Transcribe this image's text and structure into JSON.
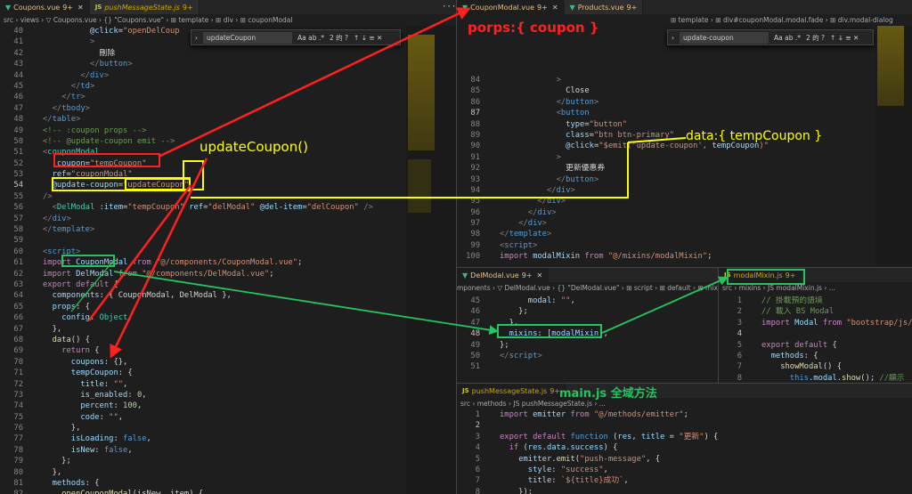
{
  "left": {
    "tabs": [
      {
        "name": "Coupons.vue",
        "badge": "9+",
        "kind": "vue"
      },
      {
        "name": "pushMessageState.js",
        "badge": "9+",
        "kind": "js"
      }
    ],
    "breadcrumb": "src › views › ▽ Coupons.vue › {} \"Coupons.vue\" › ⊞ template › ⊞ div › ⊞ couponModal",
    "find": {
      "value": "updateCoupon",
      "opts": "Aa  ab  .*",
      "count": "2 的 ?",
      "arrows": "↑  ↓  ≡  ✕"
    },
    "lines": [
      {
        "n": "40",
        "html": "<span class='w'>          </span><span class='a'>@click</span><span class='w'>=</span><span class='s'>\"openDelCoup</span>"
      },
      {
        "n": "41",
        "html": "<span class='w'>          </span><span class='p'>&gt;</span>"
      },
      {
        "n": "42",
        "html": "<span class='w'>            刪除</span>"
      },
      {
        "n": "43",
        "html": "<span class='w'>          </span><span class='p'>&lt;/</span><span class='t'>button</span><span class='p'>&gt;</span>"
      },
      {
        "n": "44",
        "html": "<span class='w'>        </span><span class='p'>&lt;/</span><span class='t'>div</span><span class='p'>&gt;</span>"
      },
      {
        "n": "45",
        "html": "<span class='w'>      </span><span class='p'>&lt;/</span><span class='t'>td</span><span class='p'>&gt;</span>"
      },
      {
        "n": "46",
        "html": "<span class='w'>    </span><span class='p'>&lt;/</span><span class='t'>tr</span><span class='p'>&gt;</span>"
      },
      {
        "n": "47",
        "html": "<span class='w'>  </span><span class='p'>&lt;/</span><span class='t'>tbody</span><span class='p'>&gt;</span>"
      },
      {
        "n": "48",
        "html": "<span class='p'>&lt;/</span><span class='t'>table</span><span class='p'>&gt;</span>"
      },
      {
        "n": "49",
        "html": "<span class='c'>&lt;!-- :coupon props --&gt;</span>"
      },
      {
        "n": "50",
        "html": "<span class='c'>&lt;!-- @update-coupon emit --&gt;</span>"
      },
      {
        "n": "51",
        "html": "<span class='p'>&lt;</span><span class='g'>couponModal</span>"
      },
      {
        "n": "52",
        "html": "<span class='w'>  </span><span class='a'>:coupon</span><span class='w'>=</span><span class='s'>\"tempCoupon\"</span>"
      },
      {
        "n": "53",
        "html": "<span class='w'>  </span><span class='a'>ref</span><span class='w'>=</span><span class='s'>\"couponModal\"</span>"
      },
      {
        "n": "54",
        "html": "<span class='w'>  </span><span class='a'>@update-coupon</span><span class='w'>=</span><span class='s'>\"updateCoupon\"</span>"
      },
      {
        "n": "55",
        "html": "<span class='p'>/&gt;</span>"
      },
      {
        "n": "56",
        "html": "<span class='p'>&lt;</span><span class='g'>DelModal</span><span class='w'> </span><span class='a'>:item</span><span class='w'>=</span><span class='s'>\"tempCoupon\"</span><span class='w'> </span><span class='a'>ref</span><span class='w'>=</span><span class='s'>\"delModal\"</span><span class='w'> </span><span class='a'>@del-item</span><span class='w'>=</span><span class='s'>\"delCoupon\"</span><span class='w'> </span><span class='p'>/&gt;</span>",
        "indent": "  "
      },
      {
        "n": "57",
        "html": "<span class='p'>&lt;/</span><span class='t'>div</span><span class='p'>&gt;</span>"
      },
      {
        "n": "58",
        "html": "<span class='p'>&lt;/</span><span class='t'>template</span><span class='p'>&gt;</span>"
      },
      {
        "n": "59",
        "html": ""
      },
      {
        "n": "60",
        "html": "<span class='p'>&lt;</span><span class='t'>script</span><span class='p'>&gt;</span>"
      },
      {
        "n": "61",
        "html": "<span class='kw'>import</span><span class='w'> </span><span class='a'>CouponModal</span><span class='w'> </span><span class='kw'>from</span><span class='w'> </span><span class='s'>\"@/components/CouponModal.vue\"</span><span class='w'>;</span>"
      },
      {
        "n": "62",
        "html": "<span class='kw'>import</span><span class='w'> </span><span class='a'>DelModal</span><span class='w'> </span><span class='kw'>from</span><span class='w'> </span><span class='s'>\"@/components/DelModal.vue\"</span><span class='w'>;</span>"
      },
      {
        "n": "63",
        "html": "<span class='kw'>export</span><span class='w'> </span><span class='kw'>default</span><span class='w'> {</span>"
      },
      {
        "n": "64",
        "html": "<span class='w'>  </span><span class='a'>components</span><span class='w'>: { CouponModal, DelModal },</span>"
      },
      {
        "n": "65",
        "html": "<span class='w'>  </span><span class='a'>props</span><span class='w'>: {</span>"
      },
      {
        "n": "66",
        "html": "<span class='w'>    </span><span class='a'>config</span><span class='w'>: </span><span class='g'>Object</span><span class='w'>,</span>"
      },
      {
        "n": "67",
        "html": "<span class='w'>  },</span>"
      },
      {
        "n": "68",
        "html": "<span class='w'>  </span><span class='f'>data</span><span class='w'>() {</span>"
      },
      {
        "n": "69",
        "html": "<span class='w'>    </span><span class='kw'>return</span><span class='w'> {</span>"
      },
      {
        "n": "70",
        "html": "<span class='w'>      </span><span class='a'>coupons</span><span class='w'>: {},</span>"
      },
      {
        "n": "71",
        "html": "<span class='w'>      </span><span class='a'>tempCoupon</span><span class='w'>: {</span>"
      },
      {
        "n": "72",
        "html": "<span class='w'>        </span><span class='a'>title</span><span class='w'>: </span><span class='s'>\"\"</span><span class='w'>,</span>"
      },
      {
        "n": "73",
        "html": "<span class='w'>        </span><span class='a'>is_enabled</span><span class='w'>: </span><span class='nm'>0</span><span class='w'>,</span>"
      },
      {
        "n": "74",
        "html": "<span class='w'>        </span><span class='a'>percent</span><span class='w'>: </span><span class='nm'>100</span><span class='w'>,</span>"
      },
      {
        "n": "75",
        "html": "<span class='w'>        </span><span class='a'>code</span><span class='w'>: </span><span class='s'>\"\"</span><span class='w'>,</span>"
      },
      {
        "n": "76",
        "html": "<span class='w'>      },</span>"
      },
      {
        "n": "77",
        "html": "<span class='w'>      </span><span class='a'>isLoading</span><span class='w'>: </span><span class='k'>false</span><span class='w'>,</span>"
      },
      {
        "n": "78",
        "html": "<span class='w'>      </span><span class='a'>isNew</span><span class='w'>: </span><span class='k'>false</span><span class='w'>,</span>"
      },
      {
        "n": "79",
        "html": "<span class='w'>    };</span>"
      },
      {
        "n": "80",
        "html": "<span class='w'>  },</span>"
      },
      {
        "n": "81",
        "html": "<span class='w'>  </span><span class='a'>methods</span><span class='w'>: {</span>"
      },
      {
        "n": "82",
        "html": "<span class='w'>    </span><span class='f'>openCouponModal</span><span class='w'>(isNew, item) {</span>"
      }
    ]
  },
  "right_top": {
    "tabs": [
      {
        "name": "CouponModal.vue",
        "badge": "9+",
        "kind": "vue"
      },
      {
        "name": "Products.vue",
        "badge": "9+",
        "kind": "vue"
      }
    ],
    "breadcrumb": "⊞ template › ⊞ div#couponModal.modal.fade › ⊞ div.modal-dialog",
    "find": {
      "value": "update-coupon",
      "opts": "Aa  ab  .*",
      "count": "2 的 ?",
      "arrows": "↑  ↓  ≡  ✕"
    },
    "lines": [
      {
        "n": "84",
        "html": "<span class='w'>            </span><span class='p'>&gt;</span>"
      },
      {
        "n": "85",
        "html": "<span class='w'>              Close</span>"
      },
      {
        "n": "86",
        "html": "<span class='w'>            </span><span class='p'>&lt;/</span><span class='t'>button</span><span class='p'>&gt;</span>"
      },
      {
        "n": "87",
        "html": "<span class='w'>            </span><span class='p'>&lt;</span><span class='t'>button</span>"
      },
      {
        "n": "88",
        "html": "<span class='w'>              </span><span class='a'>type</span><span class='w'>=</span><span class='s'>\"button\"</span>"
      },
      {
        "n": "89",
        "html": "<span class='w'>              </span><span class='a'>class</span><span class='w'>=</span><span class='s'>\"btn btn-primary\"</span>"
      },
      {
        "n": "90",
        "html": "<span class='w'>              </span><span class='a'>@click</span><span class='w'>=</span><span class='s'>\"$emit('update-coupon', </span><span class='a'>tempCoupon</span><span class='s'>)\"</span>"
      },
      {
        "n": "91",
        "html": "<span class='w'>            </span><span class='p'>&gt;</span>"
      },
      {
        "n": "92",
        "html": "<span class='w'>              更新優惠券</span>"
      },
      {
        "n": "93",
        "html": "<span class='w'>            </span><span class='p'>&lt;/</span><span class='t'>button</span><span class='p'>&gt;</span>"
      },
      {
        "n": "94",
        "html": "<span class='w'>          </span><span class='p'>&lt;/</span><span class='t'>div</span><span class='p'>&gt;</span>"
      },
      {
        "n": "95",
        "html": "<span class='w'>        </span><span class='p'>&lt;/</span><span class='t'>div</span><span class='p'>&gt;</span>"
      },
      {
        "n": "96",
        "html": "<span class='w'>      </span><span class='p'>&lt;/</span><span class='t'>div</span><span class='p'>&gt;</span>"
      },
      {
        "n": "97",
        "html": "<span class='w'>    </span><span class='p'>&lt;/</span><span class='t'>div</span><span class='p'>&gt;</span>"
      },
      {
        "n": "98",
        "html": "<span class='p'>&lt;/</span><span class='t'>template</span><span class='p'>&gt;</span>"
      },
      {
        "n": "99",
        "html": "<span class='p'>&lt;</span><span class='t'>script</span><span class='p'>&gt;</span>"
      },
      {
        "n": "100",
        "html": "<span class='kw'>import</span><span class='w'> </span><span class='a'>modalMixin</span><span class='w'> </span><span class='kw'>from</span><span class='w'> </span><span class='s'>\"@/mixins/modalMixin\"</span><span class='w'>;</span>"
      }
    ]
  },
  "del_modal": {
    "tab": {
      "name": "DelModal.vue",
      "badge": "9+"
    },
    "breadcrumb": "mponents › ▽ DelModal.vue › {} \"DelModal.vue\" › ⊞ script › ⊞ default › ⊞ mixins",
    "lines": [
      {
        "n": "45",
        "html": "<span class='w'>      </span><span class='a'>modal</span><span class='w'>: </span><span class='s'>\"\"</span><span class='w'>,</span>"
      },
      {
        "n": "46",
        "html": "<span class='w'>    };</span>"
      },
      {
        "n": "47",
        "html": "<span class='w'>  },</span>"
      },
      {
        "n": "48",
        "html": "<span class='w'>  </span><span class='a'>mixins</span><span class='w'>: [</span><span class='a'>modalMixin</span><span class='w'>],</span>"
      },
      {
        "n": "49",
        "html": "<span class='w'>};</span>"
      },
      {
        "n": "50",
        "html": "<span class='p'>&lt;/</span><span class='t'>script</span><span class='p'>&gt;</span>"
      },
      {
        "n": "51",
        "html": ""
      }
    ]
  },
  "modal_mixin": {
    "tab": {
      "name": "modalMixin.js",
      "badge": "9+"
    },
    "breadcrumb": "src › mixins › JS modalMixin.js › ...",
    "lines": [
      {
        "n": "1",
        "html": "<span class='c'>// 掛載預的語境</span>"
      },
      {
        "n": "2",
        "html": "<span class='c'>// 載入 BS Modal</span>"
      },
      {
        "n": "3",
        "html": "<span class='kw'>import</span><span class='w'> </span><span class='a'>Modal</span><span class='w'> </span><span class='kw'>from</span><span class='w'> </span><span class='s'>\"bootstrap/js/dis</span>"
      },
      {
        "n": "4",
        "html": ""
      },
      {
        "n": "5",
        "html": "<span class='kw'>export</span><span class='w'> </span><span class='kw'>default</span><span class='w'> {</span>"
      },
      {
        "n": "6",
        "html": "<span class='w'>  </span><span class='a'>methods</span><span class='w'>: {</span>"
      },
      {
        "n": "7",
        "html": "<span class='w'>    </span><span class='f'>showModal</span><span class='w'>() {</span>"
      },
      {
        "n": "8",
        "html": "<span class='w'>      </span><span class='k'>this</span><span class='w'>.</span><span class='a'>modal</span><span class='w'>.</span><span class='f'>show</span><span class='w'>(); </span><span class='c'>//顯示</span>"
      }
    ]
  },
  "push_message": {
    "tab": {
      "name": "pushMessageState.js",
      "badge": "9+"
    },
    "breadcrumb": "src › methods › JS pushMessageState.js › ...",
    "lines": [
      {
        "n": "1",
        "html": "<span class='kw'>import</span><span class='w'> </span><span class='a'>emitter</span><span class='w'> </span><span class='kw'>from</span><span class='w'> </span><span class='s'>\"@/methods/emitter\"</span><span class='w'>;</span>"
      },
      {
        "n": "2",
        "html": ""
      },
      {
        "n": "3",
        "html": "<span class='kw'>export</span><span class='w'> </span><span class='kw'>default</span><span class='w'> </span><span class='k'>function</span><span class='w'> (</span><span class='a'>res</span><span class='w'>, </span><span class='a'>title</span><span class='w'> = </span><span class='s'>\"更新\"</span><span class='w'>) {</span>"
      },
      {
        "n": "4",
        "html": "<span class='w'>  </span><span class='kw'>if</span><span class='w'> (</span><span class='a'>res</span><span class='w'>.</span><span class='a'>data</span><span class='w'>.</span><span class='a'>success</span><span class='w'>) {</span>"
      },
      {
        "n": "5",
        "html": "<span class='w'>    </span><span class='a'>emitter</span><span class='w'>.</span><span class='f'>emit</span><span class='w'>(</span><span class='s'>\"push-message\"</span><span class='w'>, {</span>"
      },
      {
        "n": "6",
        "html": "<span class='w'>      </span><span class='a'>style</span><span class='w'>: </span><span class='s'>\"success\"</span><span class='w'>,</span>"
      },
      {
        "n": "7",
        "html": "<span class='w'>      </span><span class='a'>title</span><span class='w'>: </span><span class='s'>`${title}成功`</span><span class='w'>,</span>"
      },
      {
        "n": "8",
        "html": "<span class='w'>    });</span>"
      }
    ]
  },
  "annotations": {
    "props_label": "porps:{ coupon }",
    "method_label": "updateCoupon()",
    "data_label": "data:{ tempCoupon }",
    "main_label": "main.js 全域方法"
  },
  "colors": {
    "red": "#ff2020",
    "yellow": "#ffff00",
    "green": "#22c55e"
  }
}
